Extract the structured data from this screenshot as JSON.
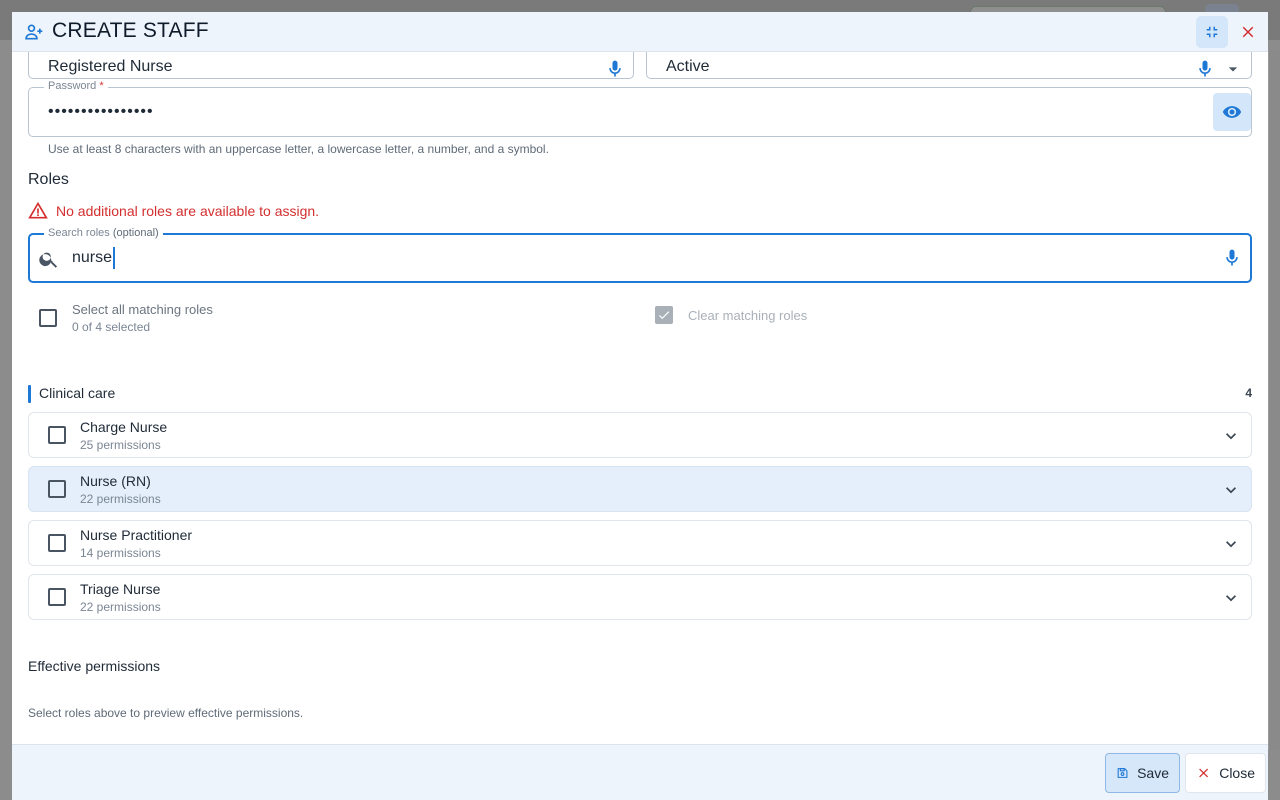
{
  "background": {
    "brand_fragment": ""
  },
  "dialog": {
    "title": "CREATE STAFF",
    "icons": {
      "title": "person-add-icon",
      "minimize": "fullscreen-exit-icon",
      "close": "close-icon"
    }
  },
  "fields": {
    "job_title": {
      "value": "Registered Nurse"
    },
    "status": {
      "value": "Active"
    },
    "password": {
      "label": "Password",
      "required_mark": "*",
      "value": "••••••••••••••••",
      "helper": "Use at least 8 characters with an uppercase letter, a lowercase letter, a number, and a symbol."
    }
  },
  "roles": {
    "heading": "Roles",
    "warning": "No additional roles are available to assign.",
    "search": {
      "label": "Search roles",
      "label_suffix": "(optional)",
      "value": "nurse"
    },
    "select_all": {
      "label": "Select all matching roles",
      "sub": "0 of 4 selected"
    },
    "clear_matching": {
      "label": "Clear matching roles"
    },
    "group": {
      "title": "Clinical care",
      "count": "4",
      "items": [
        {
          "name": "Charge Nurse",
          "permissions": "25 permissions"
        },
        {
          "name": "Nurse (RN)",
          "permissions": "22 permissions"
        },
        {
          "name": "Nurse Practitioner",
          "permissions": "14 permissions"
        },
        {
          "name": "Triage Nurse",
          "permissions": "22 permissions"
        }
      ]
    }
  },
  "effective": {
    "title": "Effective permissions",
    "hint": "Select roles above to preview effective permissions."
  },
  "footer": {
    "save_label": "Save",
    "close_label": "Close"
  },
  "colors": {
    "accent": "#1e78d6",
    "error": "#d32f2f",
    "header_bg": "#eef4fb",
    "highlight_row": "#e4effb"
  }
}
